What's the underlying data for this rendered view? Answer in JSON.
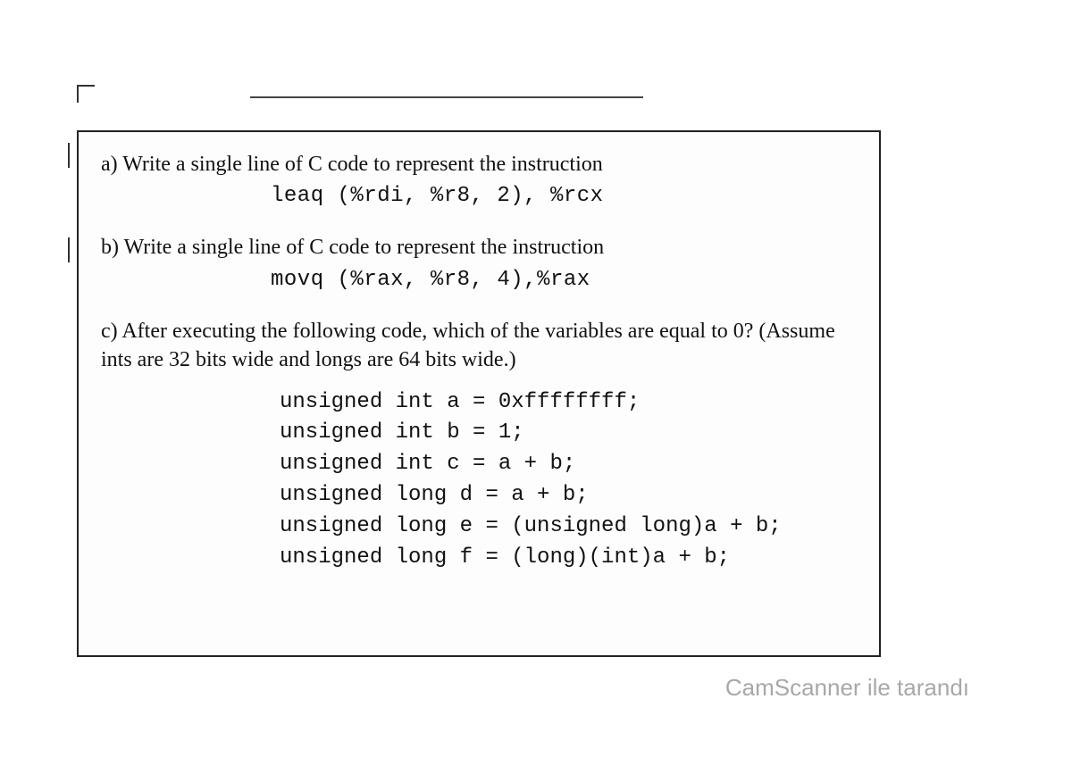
{
  "problem_a": {
    "label": "a)",
    "text": " Write a single line of C code to represent the instruction",
    "code": "leaq  (%rdi, %r8, 2), %rcx"
  },
  "problem_b": {
    "label": "b)",
    "text": " Write a single line of C code to represent the instruction",
    "code": "movq  (%rax, %r8, 4),%rax"
  },
  "problem_c": {
    "label": "c)",
    "text": " After executing the following code, which of the variables are equal to 0? (Assume ints are 32 bits wide and longs are 64 bits wide.)",
    "code_lines": [
      "unsigned int a = 0xffffffff;",
      "unsigned int b = 1;",
      "unsigned int c = a + b;",
      "unsigned long d = a + b;",
      "unsigned long e = (unsigned long)a + b;",
      "unsigned long f = (long)(int)a + b;"
    ]
  },
  "watermark": "CamScanner ile tarandı"
}
